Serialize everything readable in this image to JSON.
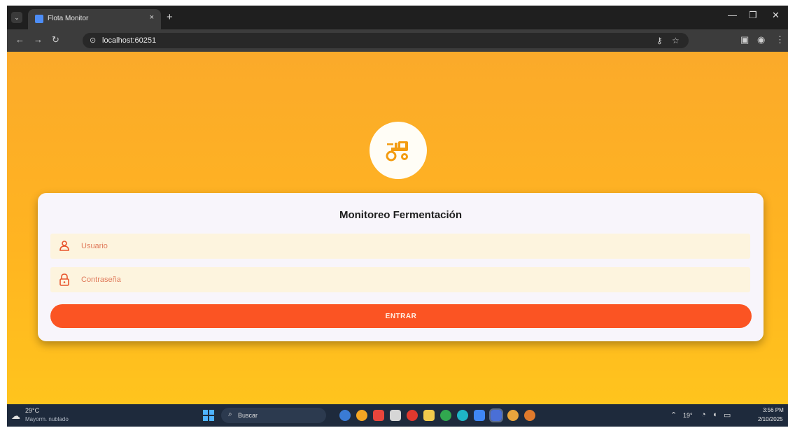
{
  "browser": {
    "tab_title": "Flota Monitor",
    "tab_close": "×",
    "new_tab": "+",
    "menu_icon": "⌄",
    "url": "localhost:60251",
    "window_min": "—",
    "window_restore": "❐",
    "window_close": "✕"
  },
  "login": {
    "title": "Monitoreo Fermentación",
    "username_placeholder": "Usuario",
    "password_placeholder": "Contraseña",
    "submit_label": "ENTRAR",
    "logo_icon": "tractor-icon"
  },
  "taskbar": {
    "weather_temp": "29°C",
    "weather_condition": "Mayorm. nublado",
    "search_label": "Buscar",
    "tray_temp": "19°",
    "time": "3:56 PM",
    "date": "2/10/2025"
  },
  "colors": {
    "accent": "#fb5423",
    "background_top": "#fbaa2a",
    "background_bottom": "#ffc41d",
    "logo_icon": "#f39c12"
  }
}
